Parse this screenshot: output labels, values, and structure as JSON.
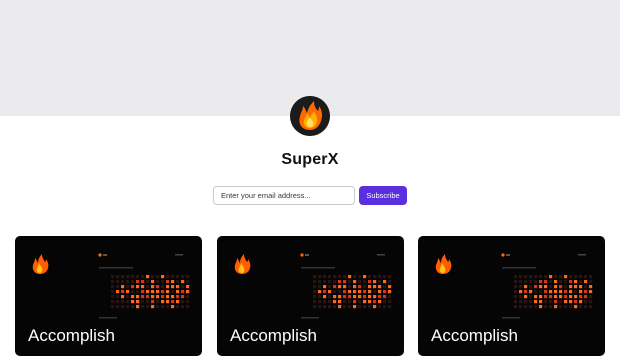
{
  "site": {
    "name": "SuperX"
  },
  "subscribe": {
    "placeholder": "Enter your email address...",
    "button_label": "Subscribe"
  },
  "posts": [
    {
      "title": "Accomplish"
    },
    {
      "title": "Accomplish"
    },
    {
      "title": "Accomplish"
    }
  ],
  "colors": {
    "accent": "#5a2fe0",
    "banner": "#ebebed",
    "card": "#050505",
    "flame_outer": "#ff7a00",
    "flame_inner": "#ffc21a"
  },
  "icons": {
    "logo": "flame-icon"
  }
}
